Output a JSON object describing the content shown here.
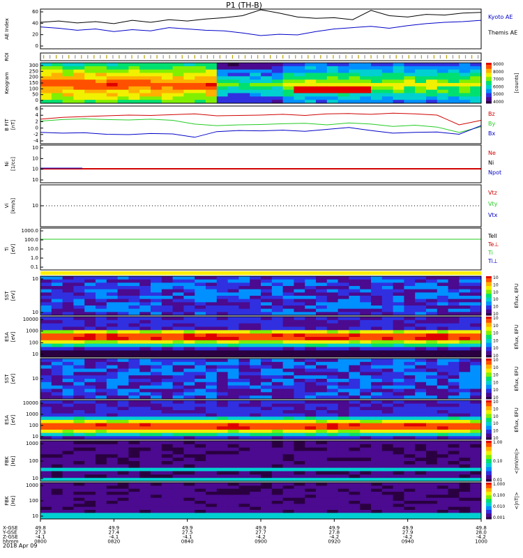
{
  "title": "P1 (TH-B)",
  "date_label": "2018 Apr 09",
  "colors": {
    "red": "#d00000",
    "green": "#22cc22",
    "blue": "#0000c8",
    "black": "#000000",
    "yellow": "#ffee00",
    "cmap": [
      "#2a0040",
      "#4b0a8f",
      "#3030e0",
      "#0090ff",
      "#00d0d0",
      "#00e070",
      "#80f000",
      "#f0f000",
      "#ffb000",
      "#ff5000",
      "#e00000"
    ]
  },
  "time_ticks": [
    "0800",
    "0820",
    "0840",
    "0900",
    "0920",
    "0940",
    "1000"
  ],
  "chart_data": [
    {
      "type": "line",
      "panel": "ae",
      "ylabel": "AE Index",
      "yticks": [
        "60",
        "40",
        "20",
        "0"
      ],
      "ylim": [
        0,
        60
      ],
      "legend": [
        {
          "name": "Kyoto AE",
          "color": "blue"
        },
        {
          "name": "Themis AE",
          "color": "black"
        }
      ],
      "x": [
        0,
        5,
        10,
        15,
        20,
        25,
        30,
        35,
        40,
        45,
        50,
        55,
        60,
        65,
        70,
        75,
        80,
        85,
        90,
        95,
        100,
        105,
        110,
        115,
        120
      ],
      "series": [
        {
          "name": "Themis AE",
          "color": "black",
          "values": [
            40,
            42,
            39,
            41,
            38,
            43,
            40,
            44,
            42,
            45,
            47,
            50,
            59,
            54,
            48,
            46,
            47,
            44,
            58,
            50,
            48,
            52,
            51,
            54,
            55
          ]
        },
        {
          "name": "Kyoto AE",
          "color": "blue",
          "values": [
            33,
            31,
            28,
            30,
            26,
            29,
            27,
            32,
            30,
            28,
            27,
            24,
            20,
            22,
            21,
            26,
            30,
            32,
            34,
            31,
            35,
            38,
            40,
            41,
            43
          ]
        }
      ]
    },
    {
      "type": "bar",
      "panel": "roi",
      "ylabel": "ROI"
    },
    {
      "type": "heatmap",
      "panel": "keogram",
      "ylabel": "Keogram",
      "yticks": [
        "300",
        "250",
        "200",
        "150",
        "100",
        "50",
        "0"
      ],
      "colorbar": {
        "label": "[counts]",
        "ticks": [
          "9000",
          "8000",
          "7000",
          "6000",
          "5000",
          "4000"
        ]
      }
    },
    {
      "type": "line",
      "panel": "bfit",
      "ylabel": "B FIT",
      "units": "[nT]",
      "yticks": [
        "6",
        "4",
        "2",
        "0",
        "-2",
        "-4"
      ],
      "ylim": [
        -4,
        6
      ],
      "legend": [
        {
          "name": "Bz",
          "color": "red"
        },
        {
          "name": "By",
          "color": "green"
        },
        {
          "name": "Bx",
          "color": "blue"
        }
      ],
      "x": [
        0,
        6,
        12,
        18,
        24,
        30,
        36,
        42,
        48,
        54,
        60,
        66,
        72,
        78,
        84,
        90,
        96,
        102,
        108,
        114,
        120
      ],
      "series": [
        {
          "name": "Bz",
          "color": "red",
          "values": [
            2.5,
            3.0,
            3.2,
            3.4,
            3.6,
            3.5,
            3.7,
            3.9,
            3.4,
            3.5,
            3.6,
            3.8,
            3.5,
            3.9,
            4.0,
            3.8,
            4.1,
            3.9,
            3.6,
            1.0,
            2.2
          ]
        },
        {
          "name": "By",
          "color": "green",
          "values": [
            2.0,
            2.4,
            2.6,
            2.4,
            2.3,
            2.5,
            2.2,
            1.2,
            0.8,
            1.0,
            1.1,
            1.3,
            1.4,
            1.0,
            1.5,
            1.2,
            0.6,
            0.9,
            0.4,
            -1.0,
            0.5
          ]
        },
        {
          "name": "Bx",
          "color": "blue",
          "values": [
            -1.0,
            -1.2,
            -1.1,
            -1.5,
            -1.6,
            -1.3,
            -1.4,
            -2.3,
            -0.8,
            -0.5,
            -0.6,
            -0.4,
            -0.7,
            -0.2,
            0.3,
            -0.5,
            -1.2,
            -1.0,
            -0.9,
            -1.5,
            0.8
          ]
        }
      ]
    },
    {
      "type": "line",
      "panel": "ni",
      "ylabel": "Ni",
      "units": "[1/cc]",
      "yticks": [
        "10",
        "10",
        "10",
        "10"
      ],
      "legend": [
        {
          "name": "Ne",
          "color": "red"
        },
        {
          "name": "Ni",
          "color": "black"
        },
        {
          "name": "Npot",
          "color": "blue"
        }
      ]
    },
    {
      "type": "line",
      "panel": "vi",
      "ylabel": "Vi",
      "units": "[km/s]",
      "yticks": [
        "10"
      ],
      "legend": [
        {
          "name": "Vtz",
          "color": "red"
        },
        {
          "name": "Vty",
          "color": "green"
        },
        {
          "name": "Vtx",
          "color": "blue"
        }
      ]
    },
    {
      "type": "line",
      "panel": "ti",
      "ylabel": "Ti",
      "units": "[eV]",
      "yticks": [
        "1000.0",
        "100.0",
        "10.0",
        "1.0",
        "0.1"
      ],
      "legend": [
        {
          "name": "Tell",
          "color": "black"
        },
        {
          "name": "Te⊥",
          "color": "red"
        },
        {
          "name": "Ti",
          "color": "green"
        },
        {
          "name": "Ti⊥",
          "color": "blue"
        }
      ]
    },
    {
      "type": "heatmap",
      "panel": "sst1",
      "ylabel": "SST",
      "units": "[eV]",
      "yticks": [
        "10",
        "10"
      ],
      "colorbar": {
        "label": "Eflux, EFU",
        "ticks": [
          "10",
          "10",
          "10",
          "10",
          "10",
          "10"
        ]
      }
    },
    {
      "type": "heatmap",
      "panel": "esa1",
      "ylabel": "ESA",
      "units": "[eV]",
      "yticks": [
        "10000",
        "1000",
        "100",
        "10"
      ],
      "colorbar": {
        "label": "Eflux, EFU",
        "ticks": [
          "10",
          "10",
          "10",
          "10",
          "10",
          "10"
        ]
      }
    },
    {
      "type": "heatmap",
      "panel": "sst2",
      "ylabel": "SST",
      "units": "[eV]",
      "yticks": [
        "10"
      ],
      "colorbar": {
        "label": "Eflux, EFU",
        "ticks": [
          "10",
          "10",
          "10",
          "10",
          "10",
          "10"
        ]
      }
    },
    {
      "type": "heatmap",
      "panel": "esa2",
      "ylabel": "ESA",
      "units": "[eV]",
      "yticks": [
        "10000",
        "1000",
        "100",
        "10"
      ],
      "colorbar": {
        "label": "Eflux, EFU",
        "ticks": [
          "10",
          "10",
          "10",
          "10",
          "10",
          "10"
        ]
      }
    },
    {
      "type": "heatmap",
      "panel": "fbk1",
      "ylabel": "FBK",
      "units": "[Hz]",
      "yticks": [
        "1000",
        "100",
        "10"
      ],
      "colorbar": {
        "label": "<|mV/m|>",
        "ticks": [
          "1.00",
          "0.10",
          "0.01"
        ]
      }
    },
    {
      "type": "heatmap",
      "panel": "fbk2",
      "ylabel": "FBK",
      "units": "[Hz]",
      "yticks": [
        "1000",
        "100",
        "10"
      ],
      "colorbar": {
        "label": "<|nT|>",
        "ticks": [
          "1.000",
          "0.100",
          "0.010",
          "0.001"
        ]
      }
    }
  ],
  "orbit": {
    "labels": [
      "X-GSE",
      "Y-GSE",
      "Z-GSE",
      "hhmm"
    ],
    "columns": [
      [
        "49.8",
        "27.3",
        "-4.1",
        "0800"
      ],
      [
        "49.9",
        "27.4",
        "-4.1",
        "0820"
      ],
      [
        "49.9",
        "27.5",
        "-4.1",
        "0840"
      ],
      [
        "49.9",
        "27.7",
        "-4.2",
        "0900"
      ],
      [
        "49.9",
        "27.8",
        "-4.2",
        "0920"
      ],
      [
        "49.9",
        "27.9",
        "-4.2",
        "0940"
      ],
      [
        "49.8",
        "28.0",
        "-4.2",
        "1000"
      ]
    ]
  }
}
